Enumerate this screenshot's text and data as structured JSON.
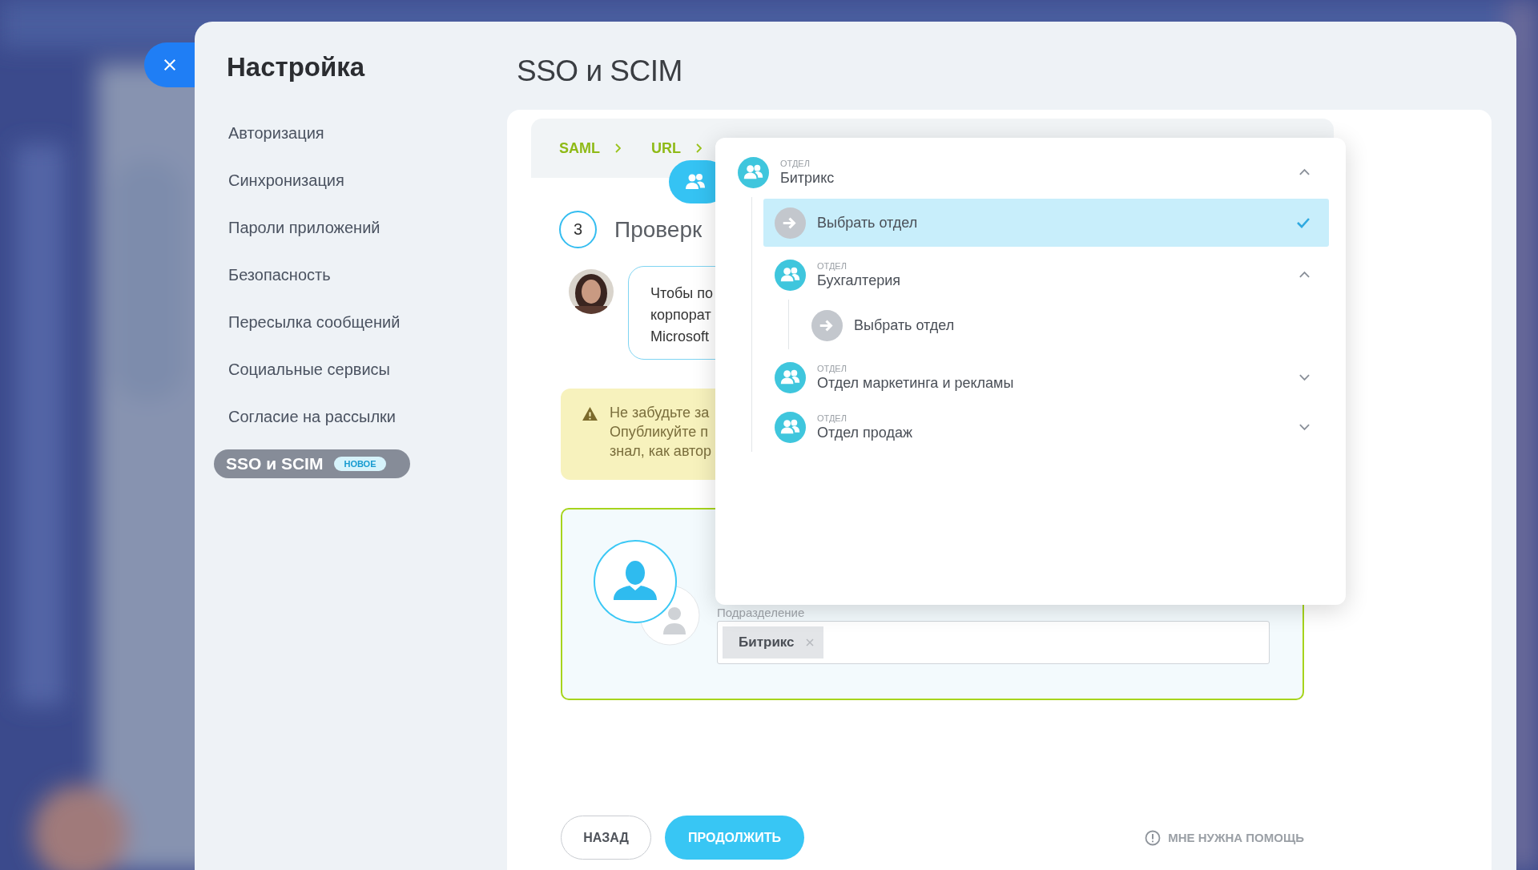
{
  "sidebar": {
    "title": "Настройка",
    "items": [
      {
        "label": "Авторизация",
        "selected": false
      },
      {
        "label": "Синхронизация",
        "selected": false
      },
      {
        "label": "Пароли приложений",
        "selected": false
      },
      {
        "label": "Безопасность",
        "selected": false
      },
      {
        "label": "Пересылка сообщений",
        "selected": false
      },
      {
        "label": "Социальные сервисы",
        "selected": false
      },
      {
        "label": "Согласие на рассылки",
        "selected": false
      },
      {
        "label": "SSO и SCIM",
        "selected": true,
        "badge": "НОВОЕ"
      }
    ]
  },
  "page": {
    "title": "SSO и SCIM"
  },
  "breadcrumbs": [
    {
      "label": "SAML"
    },
    {
      "label": "URL"
    }
  ],
  "step": {
    "number": "3",
    "title": "Проверк"
  },
  "message": {
    "lines": [
      "Чтобы по",
      "корпорат",
      "Microsoft"
    ]
  },
  "warning": {
    "lines": [
      "Не забудьте за",
      "Опубликуйте п",
      "знал, как автор"
    ]
  },
  "user_card": {
    "field_label": "Подразделение",
    "tags": [
      "Битрикс"
    ]
  },
  "dropdown": {
    "items": [
      {
        "kind": "department",
        "caption": "ОТДЕЛ",
        "name": "Битрикс",
        "expanded": true,
        "children": [
          {
            "kind": "select",
            "label": "Выбрать отдел",
            "selected": true
          },
          {
            "kind": "department",
            "caption": "ОТДЕЛ",
            "name": "Бухгалтерия",
            "expanded": true,
            "children": [
              {
                "kind": "select",
                "label": "Выбрать отдел",
                "selected": false
              }
            ]
          },
          {
            "kind": "department",
            "caption": "ОТДЕЛ",
            "name": "Отдел маркетинга и рекламы",
            "expanded": false
          },
          {
            "kind": "department",
            "caption": "ОТДЕЛ",
            "name": "Отдел продаж",
            "expanded": false
          }
        ]
      }
    ]
  },
  "buttons": {
    "back": "НАЗАД",
    "continue": "ПРОДОЛЖИТЬ"
  },
  "help_link": "МНЕ НУЖНА ПОМОЩЬ"
}
